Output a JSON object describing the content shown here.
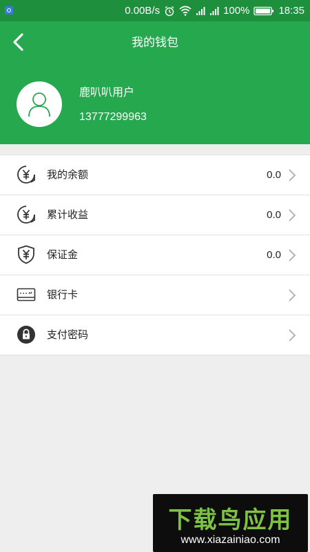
{
  "status_bar": {
    "net_speed": "0.00B/s",
    "battery": "100%",
    "time": "18:35",
    "icons": [
      "app-notification-icon",
      "alarm-icon",
      "wifi-icon",
      "signal-icon",
      "signal-icon",
      "battery-icon"
    ]
  },
  "header": {
    "title": "我的钱包",
    "back_icon": "back-arrow-icon",
    "background_color": "#26a84f"
  },
  "user": {
    "name": "鹿叭叭用户",
    "phone": "13777299963",
    "avatar_icon": "user-avatar-icon"
  },
  "menu": {
    "items": [
      {
        "label": "我的余额",
        "value": "0.0",
        "icon": "yuan-coin-icon"
      },
      {
        "label": "累计收益",
        "value": "0.0",
        "icon": "yuan-coin-icon"
      },
      {
        "label": "保证金",
        "value": "0.0",
        "icon": "yuan-shield-icon"
      },
      {
        "label": "银行卡",
        "value": "",
        "icon": "bank-card-icon"
      },
      {
        "label": "支付密码",
        "value": "",
        "icon": "lock-icon"
      }
    ]
  },
  "watermark": {
    "title": "下载鸟应用",
    "url": "www.xiazainiao.com"
  },
  "colors": {
    "status_bar": "#1e8f3c",
    "header": "#26a84f",
    "background": "#eeeeee",
    "watermark_green": "#7dc242"
  }
}
